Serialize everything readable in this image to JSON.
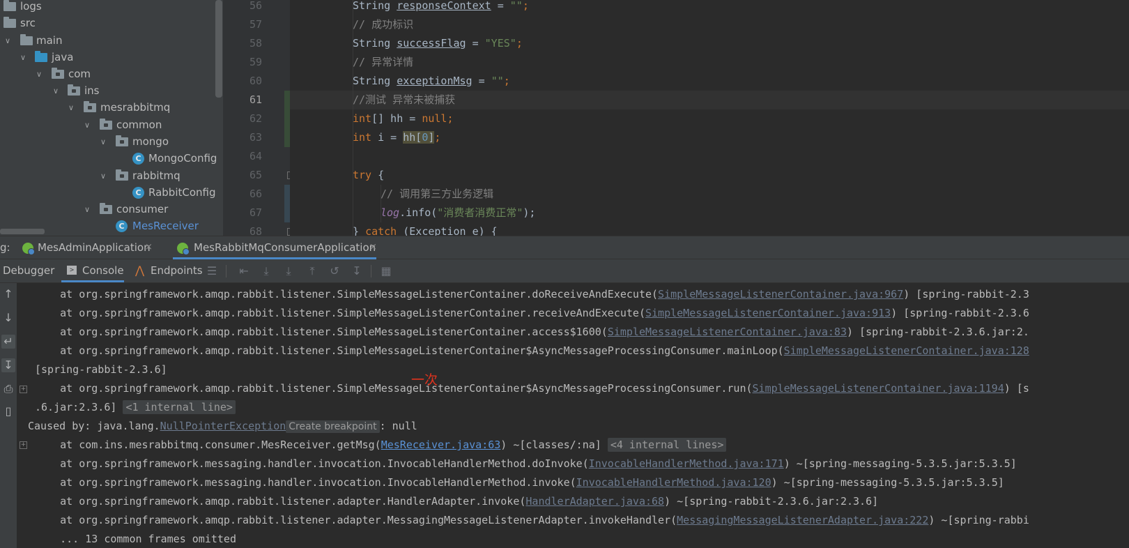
{
  "project_tree": {
    "items": [
      {
        "label": "logs",
        "kind": "folder",
        "expanded": false
      },
      {
        "label": "src",
        "kind": "folder",
        "expanded": false
      },
      {
        "label": "main",
        "kind": "folder",
        "expanded": true
      },
      {
        "label": "java",
        "kind": "source-root",
        "expanded": true
      },
      {
        "label": "com",
        "kind": "package",
        "expanded": true
      },
      {
        "label": "ins",
        "kind": "package",
        "expanded": true
      },
      {
        "label": "mesrabbitmq",
        "kind": "package",
        "expanded": true
      },
      {
        "label": "common",
        "kind": "package",
        "expanded": true
      },
      {
        "label": "mongo",
        "kind": "package",
        "expanded": true
      },
      {
        "label": "MongoConfig",
        "kind": "class"
      },
      {
        "label": "rabbitmq",
        "kind": "package",
        "expanded": true
      },
      {
        "label": "RabbitConfig",
        "kind": "class"
      },
      {
        "label": "consumer",
        "kind": "package",
        "expanded": true
      },
      {
        "label": "MesReceiver",
        "kind": "class"
      }
    ]
  },
  "editor": {
    "line_numbers": [
      "56",
      "57",
      "58",
      "59",
      "60",
      "61",
      "62",
      "63",
      "64",
      "65",
      "66",
      "67",
      "68"
    ],
    "current_line": "61",
    "lines": [
      {
        "type": "String",
        "var": "responseContext",
        "op": " = ",
        "str": "\"\"",
        "end": ";"
      },
      {
        "comment": "// 成功标识"
      },
      {
        "type": "String",
        "var": "successFlag",
        "op": " = ",
        "str": "\"YES\"",
        "end": ";"
      },
      {
        "comment": "// 异常详情"
      },
      {
        "type": "String",
        "var": "exceptionMsg",
        "op": " = ",
        "str": "\"\"",
        "end": ";"
      },
      {
        "comment": "//测试 异常未被捕获"
      },
      {
        "kw": "int",
        "rest": "[] hh = ",
        "kw2": "null",
        "end": ";"
      },
      {
        "kw": "int",
        "rest": " i = ",
        "hl": "hh[",
        "num": "0",
        "hl2": "]",
        "end": ";"
      },
      {},
      {
        "kw": "try",
        "rest": " {"
      },
      {
        "comment": "// 调用第三方业务逻辑"
      },
      {
        "field": "log",
        "rest": ".info(",
        "str": "\"消费者消费正常\"",
        "end": ");"
      },
      {
        "pre": "} ",
        "kw": "catch",
        "rest": " (Exception e) {"
      }
    ]
  },
  "run_tabs": {
    "prefix": "g:",
    "tabs": [
      {
        "label": "MesAdminApplication",
        "close": "×"
      },
      {
        "label": "MesRabbitMqConsumerApplication",
        "close": "×"
      }
    ]
  },
  "sub_tabs": {
    "debugger": "Debugger",
    "console": "Console",
    "endpoints": "Endpoints"
  },
  "console": {
    "lines": [
      {
        "text": "    at org.springframework.amqp.rabbit.listener.SimpleMessageListenerContainer.doReceiveAndExecute(",
        "link": "SimpleMessageListenerContainer.java:967",
        "tail": ") [spring-rabbit-2.3"
      },
      {
        "text": "    at org.springframework.amqp.rabbit.listener.SimpleMessageListenerContainer.receiveAndExecute(",
        "link": "SimpleMessageListenerContainer.java:913",
        "tail": ") [spring-rabbit-2.3.6"
      },
      {
        "text": "    at org.springframework.amqp.rabbit.listener.SimpleMessageListenerContainer.access$1600(",
        "link": "SimpleMessageListenerContainer.java:83",
        "tail": ") [spring-rabbit-2.3.6.jar:2."
      },
      {
        "text": "    at org.springframework.amqp.rabbit.listener.SimpleMessageListenerContainer$AsyncMessageProcessingConsumer.mainLoop(",
        "link": "SimpleMessageListenerContainer.java:128",
        "tail": ""
      },
      {
        "text": "[spring-rabbit-2.3.6]"
      },
      {
        "text": "    at org.springframework.amqp.rabbit.listener.SimpleMessageListenerContainer$AsyncMessageProcessingConsumer.run(",
        "link": "SimpleMessageListenerContainer.java:1194",
        "tail": ") [s"
      },
      {
        "text": ".6.jar:2.3.6] ",
        "pill": "<1 internal line>"
      },
      {
        "text": "Caused by: java.lang.",
        "link": "NullPointerException",
        "hint": "Create breakpoint",
        "tail": ": null"
      },
      {
        "text": "    at com.ins.mesrabbitmq.consumer.MesReceiver.getMsg(",
        "link": "MesReceiver.java:63",
        "tail": ") ~[classes/:na] ",
        "pill": "<4 internal lines>"
      },
      {
        "text": "    at org.springframework.messaging.handler.invocation.InvocableHandlerMethod.doInvoke(",
        "link": "InvocableHandlerMethod.java:171",
        "tail": ") ~[spring-messaging-5.3.5.jar:5.3.5]"
      },
      {
        "text": "    at org.springframework.messaging.handler.invocation.InvocableHandlerMethod.invoke(",
        "link": "InvocableHandlerMethod.java:120",
        "tail": ") ~[spring-messaging-5.3.5.jar:5.3.5]"
      },
      {
        "text": "    at org.springframework.amqp.rabbit.listener.adapter.HandlerAdapter.invoke(",
        "link": "HandlerAdapter.java:68",
        "tail": ") ~[spring-rabbit-2.3.6.jar:2.3.6]"
      },
      {
        "text": "    at org.springframework.amqp.rabbit.listener.adapter.MessagingMessageListenerAdapter.invokeHandler(",
        "link": "MessagingMessageListenerAdapter.java:222",
        "tail": ") ~[spring-rabbi"
      },
      {
        "text": "    ... 13 common frames omitted"
      }
    ]
  },
  "annotation": "一次",
  "colors": {
    "editor_bg": "#2b2b2b",
    "panel_bg": "#3c3f41",
    "keyword": "#cc7832",
    "string": "#6a8759",
    "comment": "#808080",
    "link": "#5a92d6",
    "annotation": "#e0331e",
    "tab_underline": "#4a88c7"
  }
}
